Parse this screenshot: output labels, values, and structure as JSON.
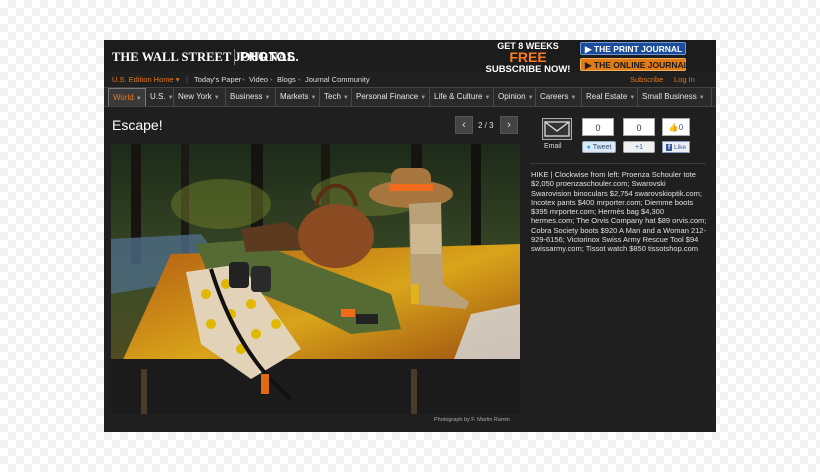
{
  "header": {
    "logo": "THE WALL STREET JOURNAL.",
    "section": "PHOTOS",
    "promo_line1": "GET 8 WEEKS",
    "promo_line2": "FREE",
    "promo_line3": "SUBSCRIBE NOW!",
    "print_button": "▶ THE PRINT JOURNAL",
    "online_button": "▶ THE ONLINE JOURNAL"
  },
  "subbar": {
    "edition": "U.S. Edition Home ▾",
    "links": [
      "Today's Paper",
      "Video",
      "Blogs",
      "Journal Community"
    ],
    "subscribe": "Subscribe",
    "login": "Log In"
  },
  "nav": {
    "items": [
      "World",
      "U.S.",
      "New York",
      "Business",
      "Markets",
      "Tech",
      "Personal Finance",
      "Life & Culture",
      "Opinion",
      "Careers",
      "Real Estate",
      "Small Business"
    ]
  },
  "slideshow": {
    "title": "Escape!",
    "counter": "2 / 3",
    "prev_icon": "chevron-left-icon",
    "next_icon": "chevron-right-icon",
    "credit": "Photograph by F. Martin Ramin",
    "description": "HIKE | Clockwise from left: Proenza Schouler tote $2,050 proenzaschouler.com; Swarovski Swarovision binoculars $2,754 swarovskioptik.com; Incotex pants $400 mrporter.com; Diemme boots $395 mrporter.com; Hermès bag $4,300 hermes.com; The Orvis Company hat $89 orvis.com; Cobra Society boots $920 A Man and a Woman 212-929-6156; Victorinox Swiss Army Rescue Tool $94 swissarmy.com; Tissot watch $850 tissotshop.com"
  },
  "share": {
    "email_label": "Email",
    "tweet_count": "0",
    "tweet_label": "Tweet",
    "plus_count": "0",
    "plus_label": "+1",
    "like_count": "0",
    "like_label": "Like"
  },
  "colors": {
    "accent_orange": "#e0751c",
    "background": "#1f1f1f"
  }
}
